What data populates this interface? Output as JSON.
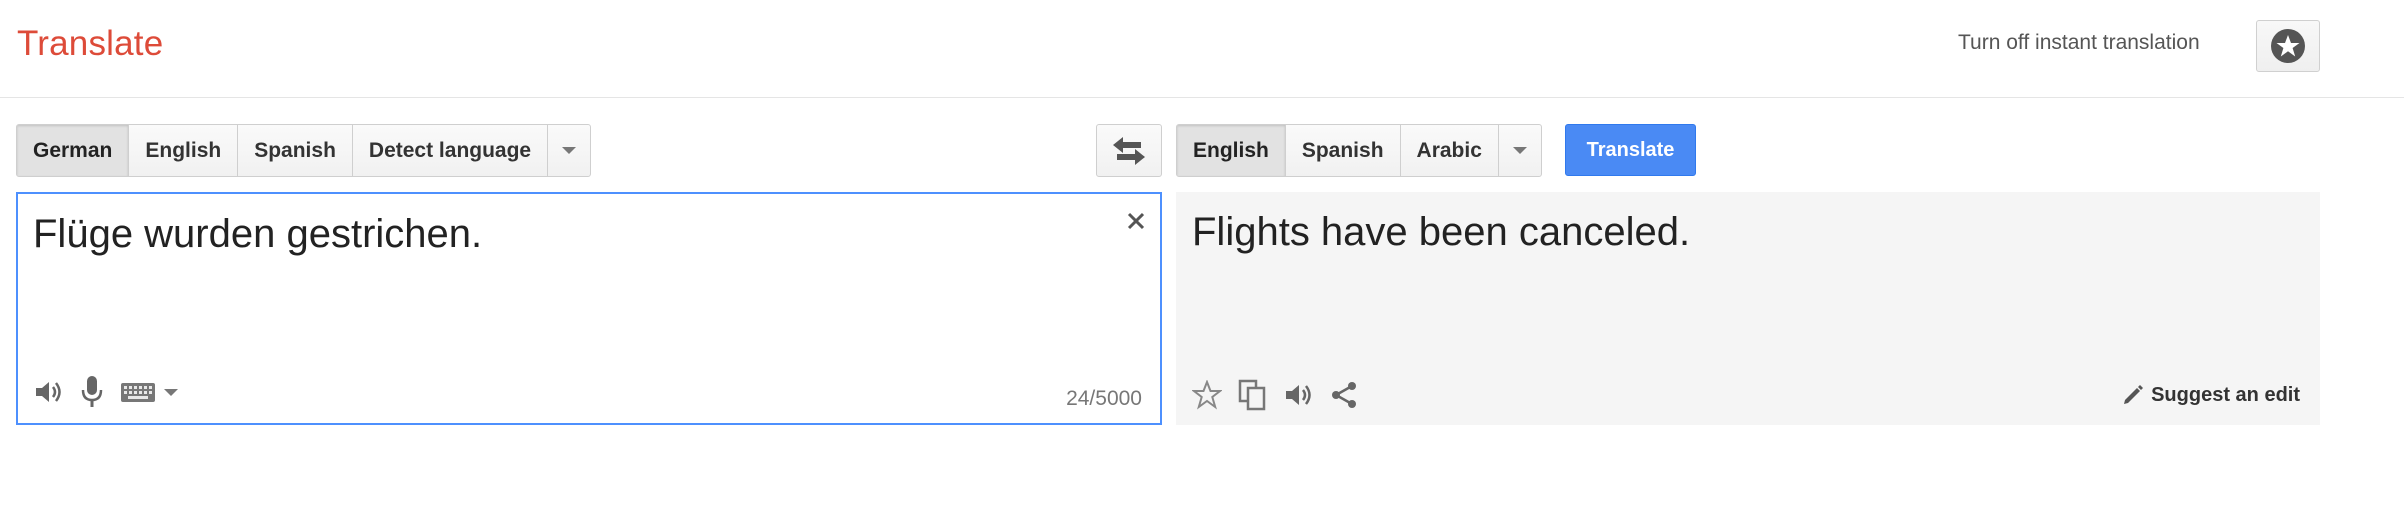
{
  "header": {
    "app_title": "Translate",
    "instant_toggle_label": "Turn off instant translation",
    "star_icon": "star-circle-icon"
  },
  "source_languages": {
    "items": [
      "German",
      "English",
      "Spanish",
      "Detect language"
    ],
    "selected": "German"
  },
  "target_languages": {
    "items": [
      "English",
      "Spanish",
      "Arabic"
    ],
    "selected": "English"
  },
  "translate_button_label": "Translate",
  "source": {
    "text": "Flüge wurden gestrichen.",
    "char_count": "24/5000",
    "tools": [
      "speaker-icon",
      "microphone-icon",
      "keyboard-icon"
    ]
  },
  "result": {
    "text": "Flights have been canceled.",
    "suggest_edit_label": "Suggest an edit",
    "tools": [
      "star-outline-icon",
      "copy-icon",
      "speaker-icon",
      "share-icon"
    ]
  },
  "colors": {
    "brand": "#dd4b39",
    "accent_blue": "#4a8af4",
    "focus_border": "#4d90fe",
    "result_bg": "#f5f5f5"
  }
}
